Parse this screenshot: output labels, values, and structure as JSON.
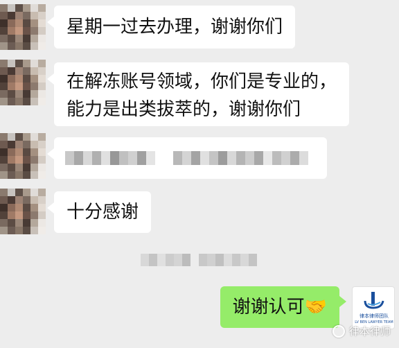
{
  "messages": [
    {
      "sender": "other",
      "text": "星期一过去办理，谢谢你们"
    },
    {
      "sender": "other",
      "lines": [
        "在解冻账号领域，你们是专业的，",
        "能力是出类拔萃的，谢谢你们"
      ]
    },
    {
      "sender": "other",
      "text": ""
    },
    {
      "sender": "other",
      "text": "十分感谢"
    },
    {
      "sender": "me",
      "text": "谢谢认可🤝"
    }
  ],
  "timestamp_text": "",
  "logo": {
    "line1": "律本律师团队",
    "line2": "LV BEN LAWYER TEAM"
  },
  "watermark": {
    "label": "律本律师"
  },
  "colors": {
    "my_bubble": "#95ec69",
    "other_bubble": "#ffffff",
    "background": "#ededed",
    "logo_blue": "#1a4f9c"
  }
}
